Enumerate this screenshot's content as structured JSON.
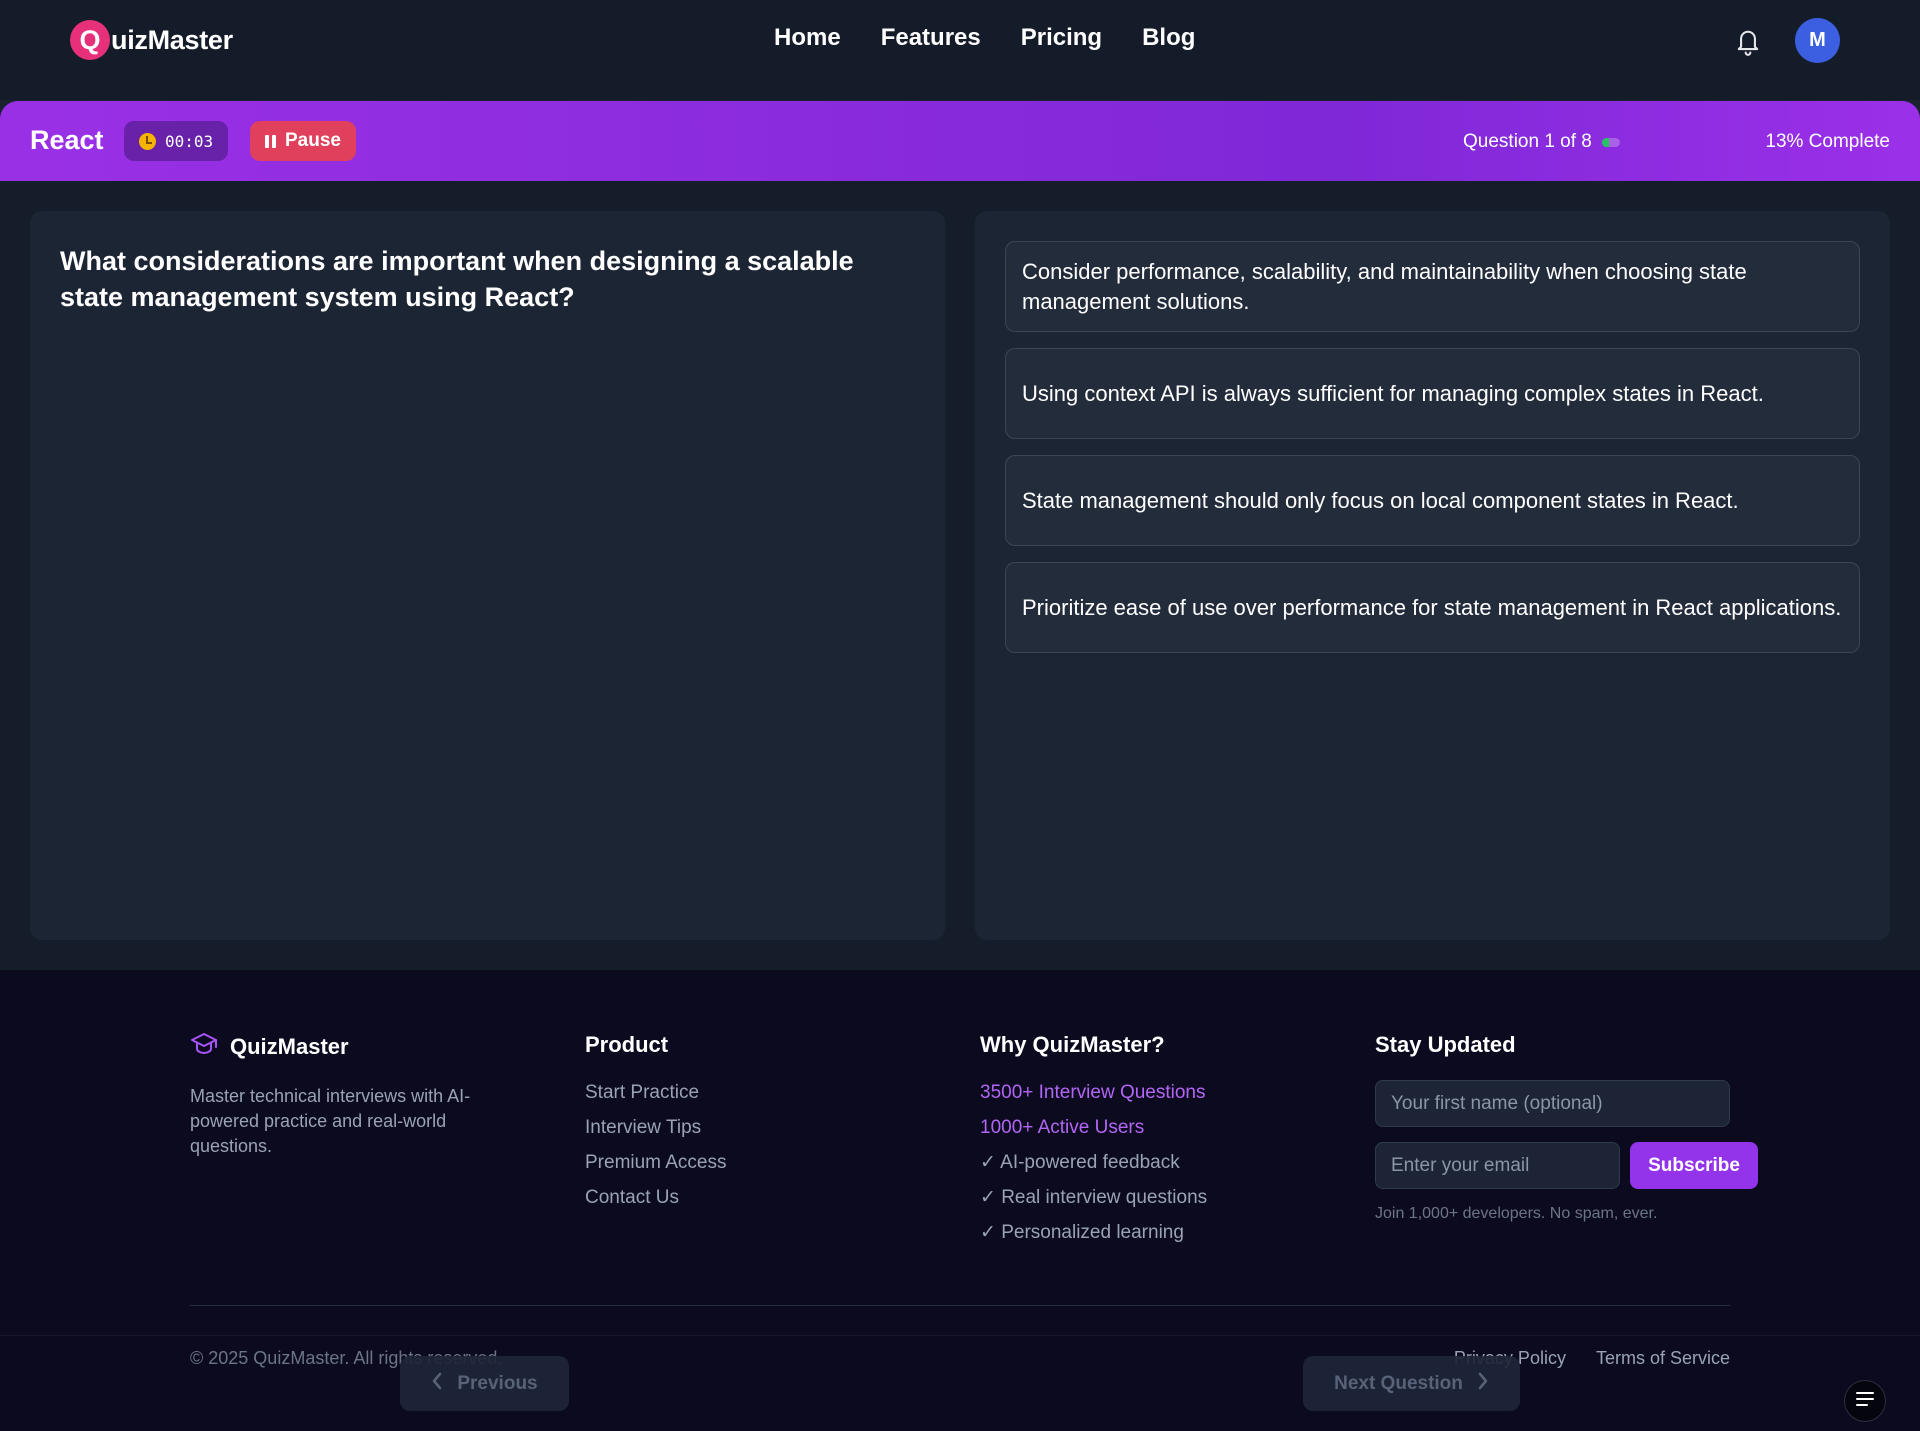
{
  "header": {
    "logo_letter": "Q",
    "logo_text": "uizMaster",
    "nav": [
      {
        "label": "Home"
      },
      {
        "label": "Features"
      },
      {
        "label": "Pricing"
      },
      {
        "label": "Blog"
      }
    ],
    "notifications_icon": "bell-icon",
    "avatar_initial": "M"
  },
  "quiz_bar": {
    "topic": "React",
    "timer_icon": "clock-icon",
    "timer": "00:03",
    "pause_label": "Pause",
    "question_progress": "Question 1 of 8",
    "progress_fraction": 0.13,
    "complete_text": "13% Complete",
    "colors": {
      "bar": "#8b2ee0",
      "pause": "#e0405c",
      "progress": "#22c55e"
    }
  },
  "question": {
    "text": "What considerations are important when designing a scalable state management system using React?"
  },
  "options": [
    {
      "text": "Consider performance, scalability, and maintainability when choosing state management solutions."
    },
    {
      "text": "Using context API is always sufficient for managing complex states in React."
    },
    {
      "text": "State management should only focus on local component states in React."
    },
    {
      "text": "Prioritize ease of use over performance for state management in React applications."
    }
  ],
  "footer": {
    "brand": "QuizMaster",
    "brand_icon": "graduation-cap-icon",
    "description": "Master technical interviews with AI-powered practice and real-world questions.",
    "product": {
      "title": "Product",
      "links": [
        "Start Practice",
        "Interview Tips",
        "Premium Access",
        "Contact Us"
      ]
    },
    "why": {
      "title": "Why QuizMaster?",
      "stats": [
        "3500+ Interview Questions",
        "1000+ Active Users"
      ],
      "features": [
        "✓ AI-powered feedback",
        "✓ Real interview questions",
        "✓ Personalized learning"
      ]
    },
    "newsletter": {
      "title": "Stay Updated",
      "name_placeholder": "Your first name (optional)",
      "email_placeholder": "Enter your email",
      "subscribe_label": "Subscribe",
      "note": "Join 1,000+ developers. No spam, ever."
    },
    "copyright": "© 2025 QuizMaster. All rights reserved.",
    "legal_links": [
      "Privacy Policy",
      "Terms of Service"
    ]
  },
  "navigation": {
    "previous_label": "Previous",
    "next_label": "Next Question"
  },
  "fab": {
    "icon": "menu-icon"
  },
  "accent_color": "#9333ea"
}
